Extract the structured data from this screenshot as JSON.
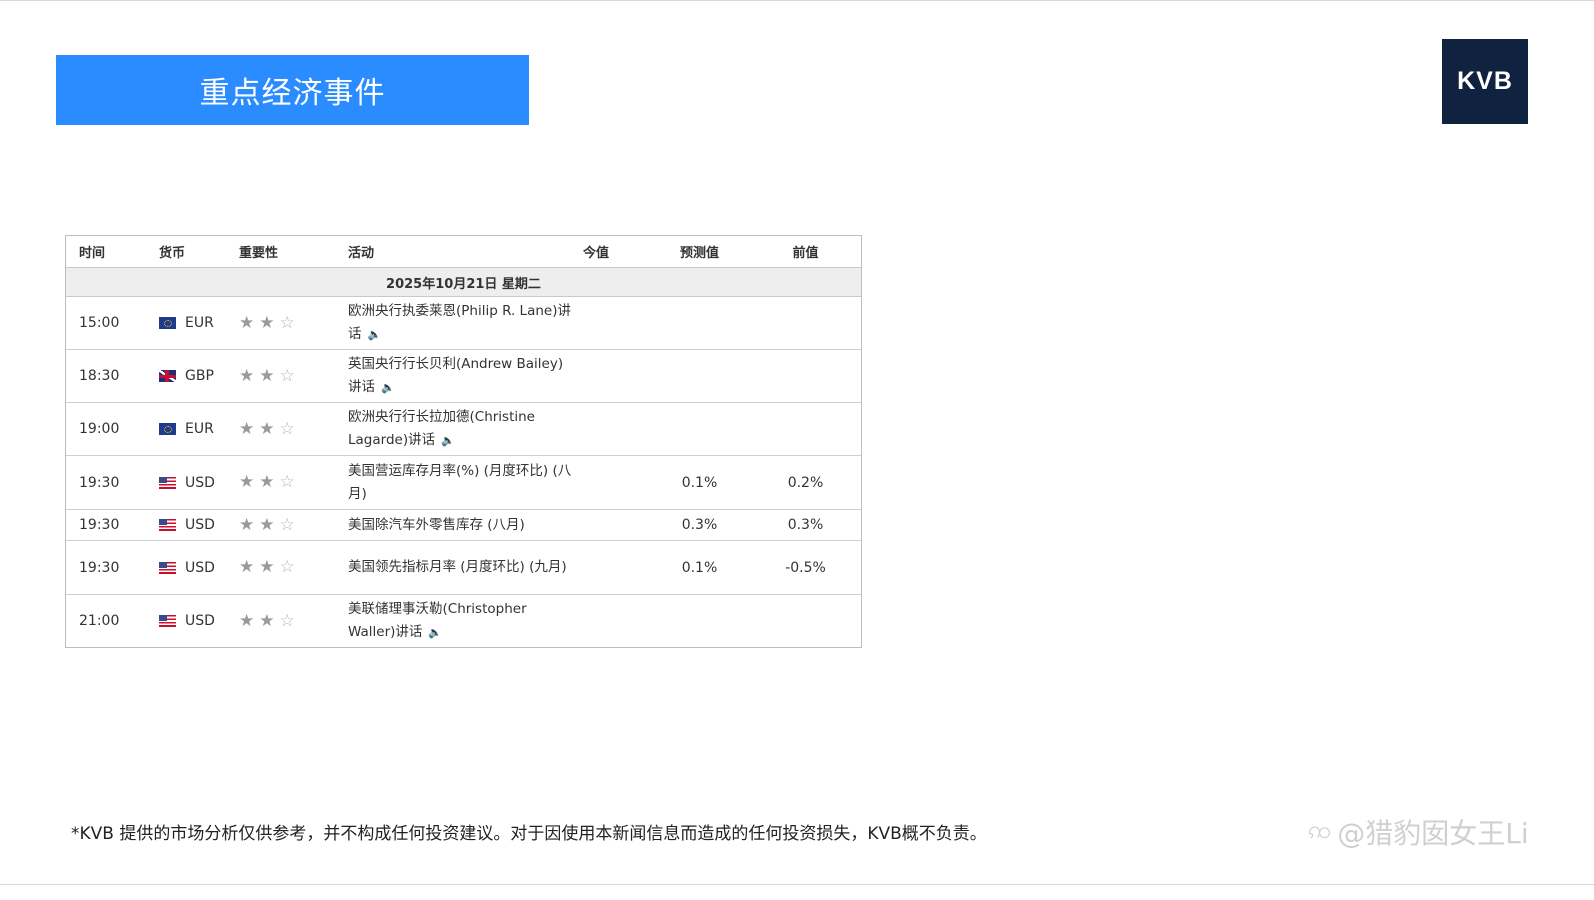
{
  "banner": {
    "title": "重点经济事件"
  },
  "logo": {
    "text": "KVB"
  },
  "calendar": {
    "headers": {
      "time": "时间",
      "currency": "货币",
      "importance": "重要性",
      "event": "活动",
      "actual": "今值",
      "forecast": "预测值",
      "previous": "前值"
    },
    "date": "2025年10月21日  星期二",
    "rows": [
      {
        "time": "15:00",
        "flag": "eu-flag-icon",
        "currency": "EUR",
        "stars": 2,
        "event": "欧洲央行执委莱恩(Philip R. Lane)讲话",
        "speaker": true,
        "actual": "",
        "forecast": "",
        "previous": ""
      },
      {
        "time": "18:30",
        "flag": "gb-flag-icon",
        "currency": "GBP",
        "stars": 2,
        "event": "英国央行行长贝利(Andrew Bailey)讲话",
        "speaker": true,
        "actual": "",
        "forecast": "",
        "previous": ""
      },
      {
        "time": "19:00",
        "flag": "eu-flag-icon",
        "currency": "EUR",
        "stars": 2,
        "event": "欧洲央行行长拉加德(Christine Lagarde)讲话",
        "speaker": true,
        "actual": "",
        "forecast": "",
        "previous": ""
      },
      {
        "time": "19:30",
        "flag": "us-flag-icon",
        "currency": "USD",
        "stars": 2,
        "event": "美国营运库存月率(%) (月度环比) (八月)",
        "speaker": false,
        "actual": "",
        "forecast": "0.1%",
        "previous": "0.2%"
      },
      {
        "time": "19:30",
        "flag": "us-flag-icon",
        "currency": "USD",
        "stars": 2,
        "event": "美国除汽车外零售库存 (八月)",
        "speaker": false,
        "actual": "",
        "forecast": "0.3%",
        "previous": "0.3%"
      },
      {
        "time": "19:30",
        "flag": "us-flag-icon",
        "currency": "USD",
        "stars": 2,
        "event": "美国领先指标月率 (月度环比) (九月)",
        "speaker": false,
        "actual": "",
        "forecast": "0.1%",
        "previous": "-0.5%"
      },
      {
        "time": "21:00",
        "flag": "us-flag-icon",
        "currency": "USD",
        "stars": 2,
        "event": "美联储理事沃勒(Christopher Waller)讲话",
        "speaker": true,
        "actual": "",
        "forecast": "",
        "previous": ""
      }
    ]
  },
  "disclaimer": "*KVB 提供的市场分析仅供参考，并不构成任何投资建议。对于因使用本新闻信息而造成的任何投资损失，KVB概不负责。",
  "watermark": "@猎豹囡女王Li"
}
